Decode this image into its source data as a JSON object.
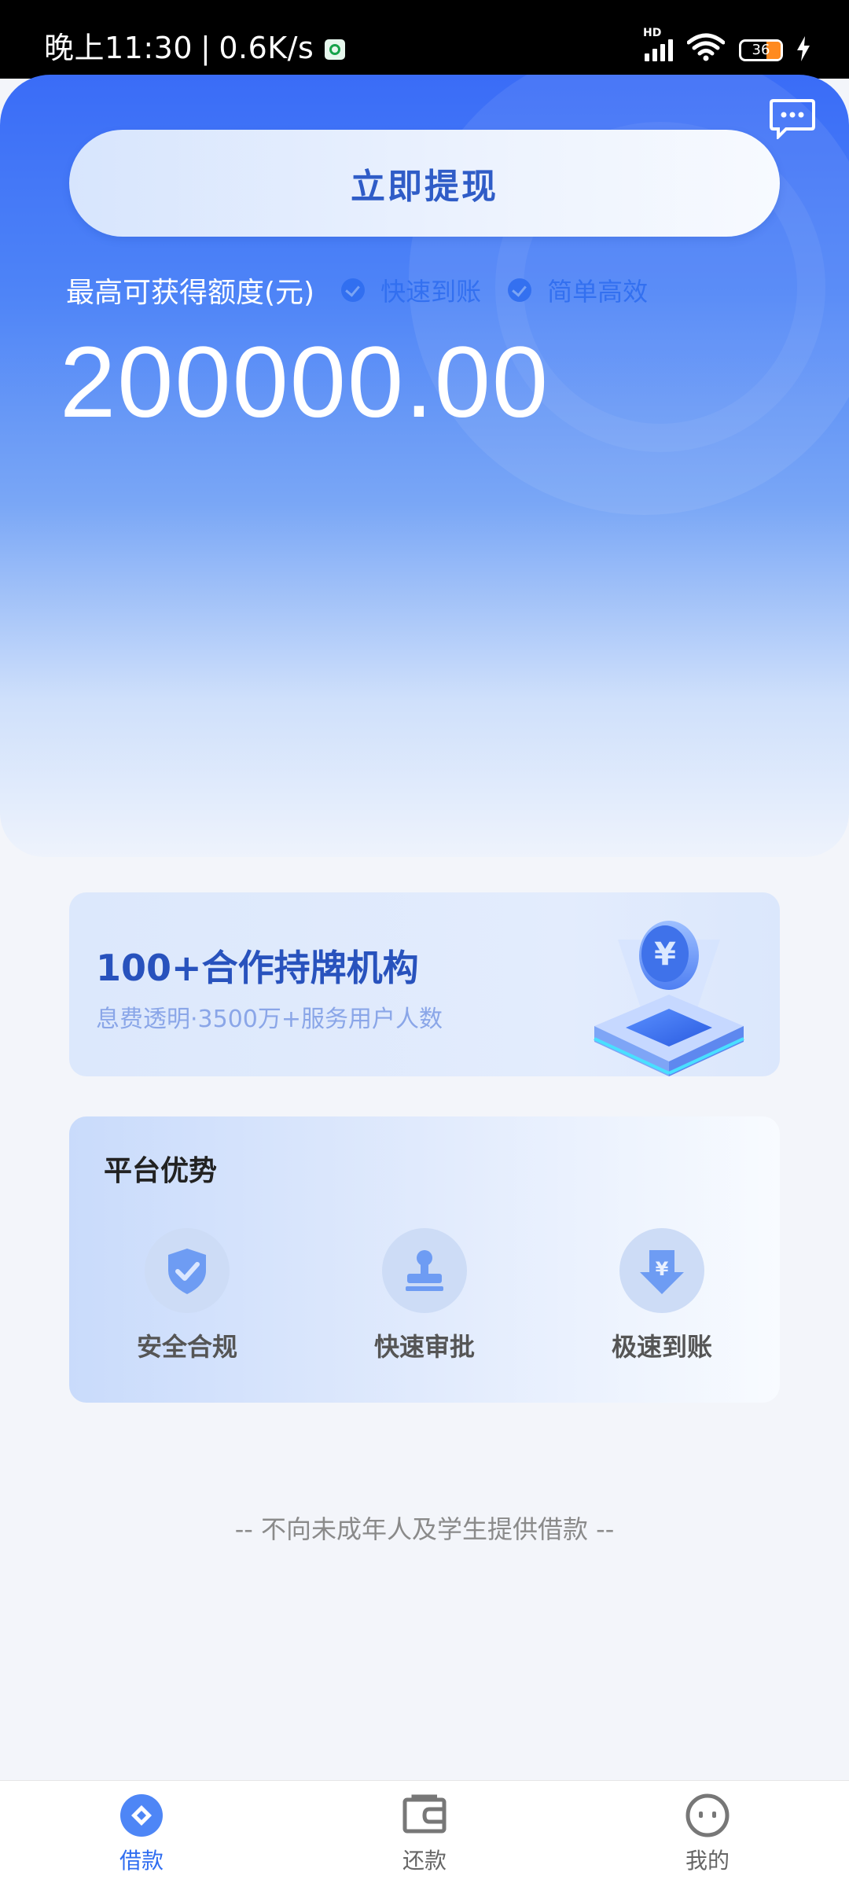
{
  "status_bar": {
    "time": "晚上11:30",
    "speed": "0.6K/s",
    "network_label": "HD",
    "battery": "36"
  },
  "hero": {
    "withdraw_button": "立即提现",
    "limit_label": "最高可获得额度(元)",
    "tags": [
      "快速到账",
      "简单高效"
    ],
    "amount": "200000.00"
  },
  "partner_card": {
    "title": "100+合作持牌机构",
    "subtitle": "息费透明·3500万+服务用户人数"
  },
  "advantages": {
    "title": "平台优势",
    "items": [
      {
        "label": "安全合规",
        "icon": "shield-check-icon"
      },
      {
        "label": "快速审批",
        "icon": "stamp-icon"
      },
      {
        "label": "极速到账",
        "icon": "yuan-arrow-down-icon"
      }
    ]
  },
  "notice": "-- 不向未成年人及学生提供借款 --",
  "bottom_nav": {
    "items": [
      {
        "label": "借款",
        "icon": "loan-icon",
        "active": true
      },
      {
        "label": "还款",
        "icon": "repay-icon",
        "active": false
      },
      {
        "label": "我的",
        "icon": "profile-icon",
        "active": false
      }
    ]
  },
  "colors": {
    "brand_blue": "#3a6cf7",
    "accent_text": "#2f5cc7",
    "active_nav": "#2f6df0"
  }
}
